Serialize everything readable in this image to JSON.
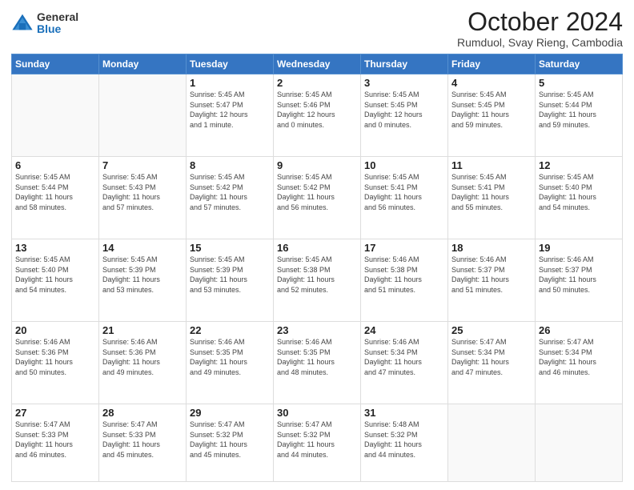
{
  "logo": {
    "general": "General",
    "blue": "Blue"
  },
  "title": "October 2024",
  "subtitle": "Rumduol, Svay Rieng, Cambodia",
  "weekdays": [
    "Sunday",
    "Monday",
    "Tuesday",
    "Wednesday",
    "Thursday",
    "Friday",
    "Saturday"
  ],
  "weeks": [
    [
      {
        "day": "",
        "detail": ""
      },
      {
        "day": "",
        "detail": ""
      },
      {
        "day": "1",
        "detail": "Sunrise: 5:45 AM\nSunset: 5:47 PM\nDaylight: 12 hours\nand 1 minute."
      },
      {
        "day": "2",
        "detail": "Sunrise: 5:45 AM\nSunset: 5:46 PM\nDaylight: 12 hours\nand 0 minutes."
      },
      {
        "day": "3",
        "detail": "Sunrise: 5:45 AM\nSunset: 5:45 PM\nDaylight: 12 hours\nand 0 minutes."
      },
      {
        "day": "4",
        "detail": "Sunrise: 5:45 AM\nSunset: 5:45 PM\nDaylight: 11 hours\nand 59 minutes."
      },
      {
        "day": "5",
        "detail": "Sunrise: 5:45 AM\nSunset: 5:44 PM\nDaylight: 11 hours\nand 59 minutes."
      }
    ],
    [
      {
        "day": "6",
        "detail": "Sunrise: 5:45 AM\nSunset: 5:44 PM\nDaylight: 11 hours\nand 58 minutes."
      },
      {
        "day": "7",
        "detail": "Sunrise: 5:45 AM\nSunset: 5:43 PM\nDaylight: 11 hours\nand 57 minutes."
      },
      {
        "day": "8",
        "detail": "Sunrise: 5:45 AM\nSunset: 5:42 PM\nDaylight: 11 hours\nand 57 minutes."
      },
      {
        "day": "9",
        "detail": "Sunrise: 5:45 AM\nSunset: 5:42 PM\nDaylight: 11 hours\nand 56 minutes."
      },
      {
        "day": "10",
        "detail": "Sunrise: 5:45 AM\nSunset: 5:41 PM\nDaylight: 11 hours\nand 56 minutes."
      },
      {
        "day": "11",
        "detail": "Sunrise: 5:45 AM\nSunset: 5:41 PM\nDaylight: 11 hours\nand 55 minutes."
      },
      {
        "day": "12",
        "detail": "Sunrise: 5:45 AM\nSunset: 5:40 PM\nDaylight: 11 hours\nand 54 minutes."
      }
    ],
    [
      {
        "day": "13",
        "detail": "Sunrise: 5:45 AM\nSunset: 5:40 PM\nDaylight: 11 hours\nand 54 minutes."
      },
      {
        "day": "14",
        "detail": "Sunrise: 5:45 AM\nSunset: 5:39 PM\nDaylight: 11 hours\nand 53 minutes."
      },
      {
        "day": "15",
        "detail": "Sunrise: 5:45 AM\nSunset: 5:39 PM\nDaylight: 11 hours\nand 53 minutes."
      },
      {
        "day": "16",
        "detail": "Sunrise: 5:45 AM\nSunset: 5:38 PM\nDaylight: 11 hours\nand 52 minutes."
      },
      {
        "day": "17",
        "detail": "Sunrise: 5:46 AM\nSunset: 5:38 PM\nDaylight: 11 hours\nand 51 minutes."
      },
      {
        "day": "18",
        "detail": "Sunrise: 5:46 AM\nSunset: 5:37 PM\nDaylight: 11 hours\nand 51 minutes."
      },
      {
        "day": "19",
        "detail": "Sunrise: 5:46 AM\nSunset: 5:37 PM\nDaylight: 11 hours\nand 50 minutes."
      }
    ],
    [
      {
        "day": "20",
        "detail": "Sunrise: 5:46 AM\nSunset: 5:36 PM\nDaylight: 11 hours\nand 50 minutes."
      },
      {
        "day": "21",
        "detail": "Sunrise: 5:46 AM\nSunset: 5:36 PM\nDaylight: 11 hours\nand 49 minutes."
      },
      {
        "day": "22",
        "detail": "Sunrise: 5:46 AM\nSunset: 5:35 PM\nDaylight: 11 hours\nand 49 minutes."
      },
      {
        "day": "23",
        "detail": "Sunrise: 5:46 AM\nSunset: 5:35 PM\nDaylight: 11 hours\nand 48 minutes."
      },
      {
        "day": "24",
        "detail": "Sunrise: 5:46 AM\nSunset: 5:34 PM\nDaylight: 11 hours\nand 47 minutes."
      },
      {
        "day": "25",
        "detail": "Sunrise: 5:47 AM\nSunset: 5:34 PM\nDaylight: 11 hours\nand 47 minutes."
      },
      {
        "day": "26",
        "detail": "Sunrise: 5:47 AM\nSunset: 5:34 PM\nDaylight: 11 hours\nand 46 minutes."
      }
    ],
    [
      {
        "day": "27",
        "detail": "Sunrise: 5:47 AM\nSunset: 5:33 PM\nDaylight: 11 hours\nand 46 minutes."
      },
      {
        "day": "28",
        "detail": "Sunrise: 5:47 AM\nSunset: 5:33 PM\nDaylight: 11 hours\nand 45 minutes."
      },
      {
        "day": "29",
        "detail": "Sunrise: 5:47 AM\nSunset: 5:32 PM\nDaylight: 11 hours\nand 45 minutes."
      },
      {
        "day": "30",
        "detail": "Sunrise: 5:47 AM\nSunset: 5:32 PM\nDaylight: 11 hours\nand 44 minutes."
      },
      {
        "day": "31",
        "detail": "Sunrise: 5:48 AM\nSunset: 5:32 PM\nDaylight: 11 hours\nand 44 minutes."
      },
      {
        "day": "",
        "detail": ""
      },
      {
        "day": "",
        "detail": ""
      }
    ]
  ]
}
